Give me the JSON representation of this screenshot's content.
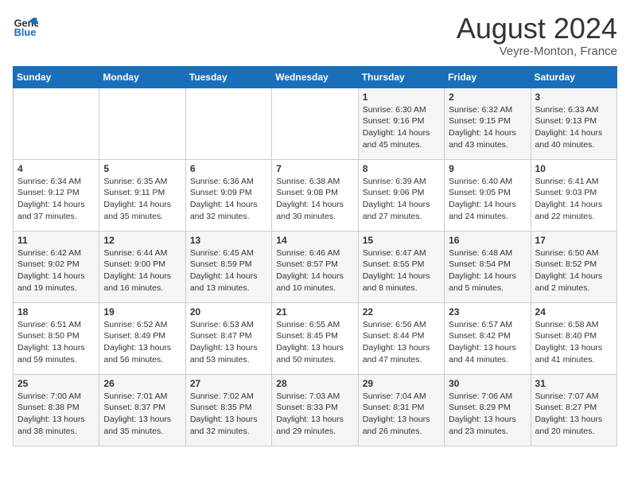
{
  "header": {
    "logo_line1": "General",
    "logo_line2": "Blue",
    "main_title": "August 2024",
    "subtitle": "Veyre-Monton, France"
  },
  "days_of_week": [
    "Sunday",
    "Monday",
    "Tuesday",
    "Wednesday",
    "Thursday",
    "Friday",
    "Saturday"
  ],
  "weeks": [
    {
      "cells": [
        {
          "day": "",
          "content": ""
        },
        {
          "day": "",
          "content": ""
        },
        {
          "day": "",
          "content": ""
        },
        {
          "day": "",
          "content": ""
        },
        {
          "day": "1",
          "content": "Sunrise: 6:30 AM\nSunset: 9:16 PM\nDaylight: 14 hours\nand 45 minutes."
        },
        {
          "day": "2",
          "content": "Sunrise: 6:32 AM\nSunset: 9:15 PM\nDaylight: 14 hours\nand 43 minutes."
        },
        {
          "day": "3",
          "content": "Sunrise: 6:33 AM\nSunset: 9:13 PM\nDaylight: 14 hours\nand 40 minutes."
        }
      ]
    },
    {
      "cells": [
        {
          "day": "4",
          "content": "Sunrise: 6:34 AM\nSunset: 9:12 PM\nDaylight: 14 hours\nand 37 minutes."
        },
        {
          "day": "5",
          "content": "Sunrise: 6:35 AM\nSunset: 9:11 PM\nDaylight: 14 hours\nand 35 minutes."
        },
        {
          "day": "6",
          "content": "Sunrise: 6:36 AM\nSunset: 9:09 PM\nDaylight: 14 hours\nand 32 minutes."
        },
        {
          "day": "7",
          "content": "Sunrise: 6:38 AM\nSunset: 9:08 PM\nDaylight: 14 hours\nand 30 minutes."
        },
        {
          "day": "8",
          "content": "Sunrise: 6:39 AM\nSunset: 9:06 PM\nDaylight: 14 hours\nand 27 minutes."
        },
        {
          "day": "9",
          "content": "Sunrise: 6:40 AM\nSunset: 9:05 PM\nDaylight: 14 hours\nand 24 minutes."
        },
        {
          "day": "10",
          "content": "Sunrise: 6:41 AM\nSunset: 9:03 PM\nDaylight: 14 hours\nand 22 minutes."
        }
      ]
    },
    {
      "cells": [
        {
          "day": "11",
          "content": "Sunrise: 6:42 AM\nSunset: 9:02 PM\nDaylight: 14 hours\nand 19 minutes."
        },
        {
          "day": "12",
          "content": "Sunrise: 6:44 AM\nSunset: 9:00 PM\nDaylight: 14 hours\nand 16 minutes."
        },
        {
          "day": "13",
          "content": "Sunrise: 6:45 AM\nSunset: 8:59 PM\nDaylight: 14 hours\nand 13 minutes."
        },
        {
          "day": "14",
          "content": "Sunrise: 6:46 AM\nSunset: 8:57 PM\nDaylight: 14 hours\nand 10 minutes."
        },
        {
          "day": "15",
          "content": "Sunrise: 6:47 AM\nSunset: 8:55 PM\nDaylight: 14 hours\nand 8 minutes."
        },
        {
          "day": "16",
          "content": "Sunrise: 6:48 AM\nSunset: 8:54 PM\nDaylight: 14 hours\nand 5 minutes."
        },
        {
          "day": "17",
          "content": "Sunrise: 6:50 AM\nSunset: 8:52 PM\nDaylight: 14 hours\nand 2 minutes."
        }
      ]
    },
    {
      "cells": [
        {
          "day": "18",
          "content": "Sunrise: 6:51 AM\nSunset: 8:50 PM\nDaylight: 13 hours\nand 59 minutes."
        },
        {
          "day": "19",
          "content": "Sunrise: 6:52 AM\nSunset: 8:49 PM\nDaylight: 13 hours\nand 56 minutes."
        },
        {
          "day": "20",
          "content": "Sunrise: 6:53 AM\nSunset: 8:47 PM\nDaylight: 13 hours\nand 53 minutes."
        },
        {
          "day": "21",
          "content": "Sunrise: 6:55 AM\nSunset: 8:45 PM\nDaylight: 13 hours\nand 50 minutes."
        },
        {
          "day": "22",
          "content": "Sunrise: 6:56 AM\nSunset: 8:44 PM\nDaylight: 13 hours\nand 47 minutes."
        },
        {
          "day": "23",
          "content": "Sunrise: 6:57 AM\nSunset: 8:42 PM\nDaylight: 13 hours\nand 44 minutes."
        },
        {
          "day": "24",
          "content": "Sunrise: 6:58 AM\nSunset: 8:40 PM\nDaylight: 13 hours\nand 41 minutes."
        }
      ]
    },
    {
      "cells": [
        {
          "day": "25",
          "content": "Sunrise: 7:00 AM\nSunset: 8:38 PM\nDaylight: 13 hours\nand 38 minutes."
        },
        {
          "day": "26",
          "content": "Sunrise: 7:01 AM\nSunset: 8:37 PM\nDaylight: 13 hours\nand 35 minutes."
        },
        {
          "day": "27",
          "content": "Sunrise: 7:02 AM\nSunset: 8:35 PM\nDaylight: 13 hours\nand 32 minutes."
        },
        {
          "day": "28",
          "content": "Sunrise: 7:03 AM\nSunset: 8:33 PM\nDaylight: 13 hours\nand 29 minutes."
        },
        {
          "day": "29",
          "content": "Sunrise: 7:04 AM\nSunset: 8:31 PM\nDaylight: 13 hours\nand 26 minutes."
        },
        {
          "day": "30",
          "content": "Sunrise: 7:06 AM\nSunset: 8:29 PM\nDaylight: 13 hours\nand 23 minutes."
        },
        {
          "day": "31",
          "content": "Sunrise: 7:07 AM\nSunset: 8:27 PM\nDaylight: 13 hours\nand 20 minutes."
        }
      ]
    }
  ]
}
